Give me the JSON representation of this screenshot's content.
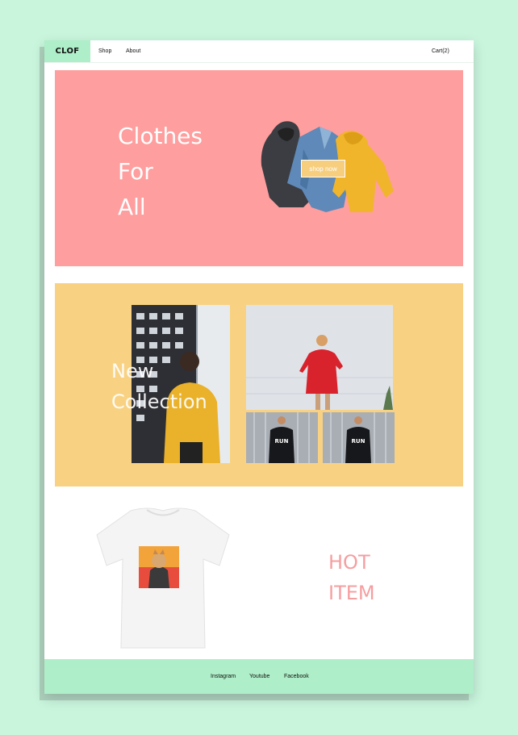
{
  "header": {
    "logo": "CLOF",
    "nav": {
      "shop": "Shop",
      "about": "About",
      "cart": "Cart(2)"
    }
  },
  "hero": {
    "title_lines": [
      "Clothes",
      "For",
      "All"
    ],
    "button_label": "shop now",
    "image": "clothes-stack-image"
  },
  "collection": {
    "title_lines": [
      "New",
      "Collection"
    ],
    "images": [
      "yellow-hoodie-photo",
      "red-sweatshirt-photo",
      "run-hoodie-photo",
      "run-hoodie-photo"
    ]
  },
  "hot_item": {
    "title_lines": [
      "HOT",
      "ITEM"
    ],
    "image": "white-tshirt-dog-print"
  },
  "footer": {
    "links": [
      "Instagram",
      "Youtube",
      "Facebook"
    ]
  },
  "colors": {
    "background": "#c9f5dd",
    "accent_green": "#aeeec8",
    "hero_pink": "#ff9e9e",
    "collection_yellow": "#f8d282",
    "hot_text": "#f59ea0"
  }
}
